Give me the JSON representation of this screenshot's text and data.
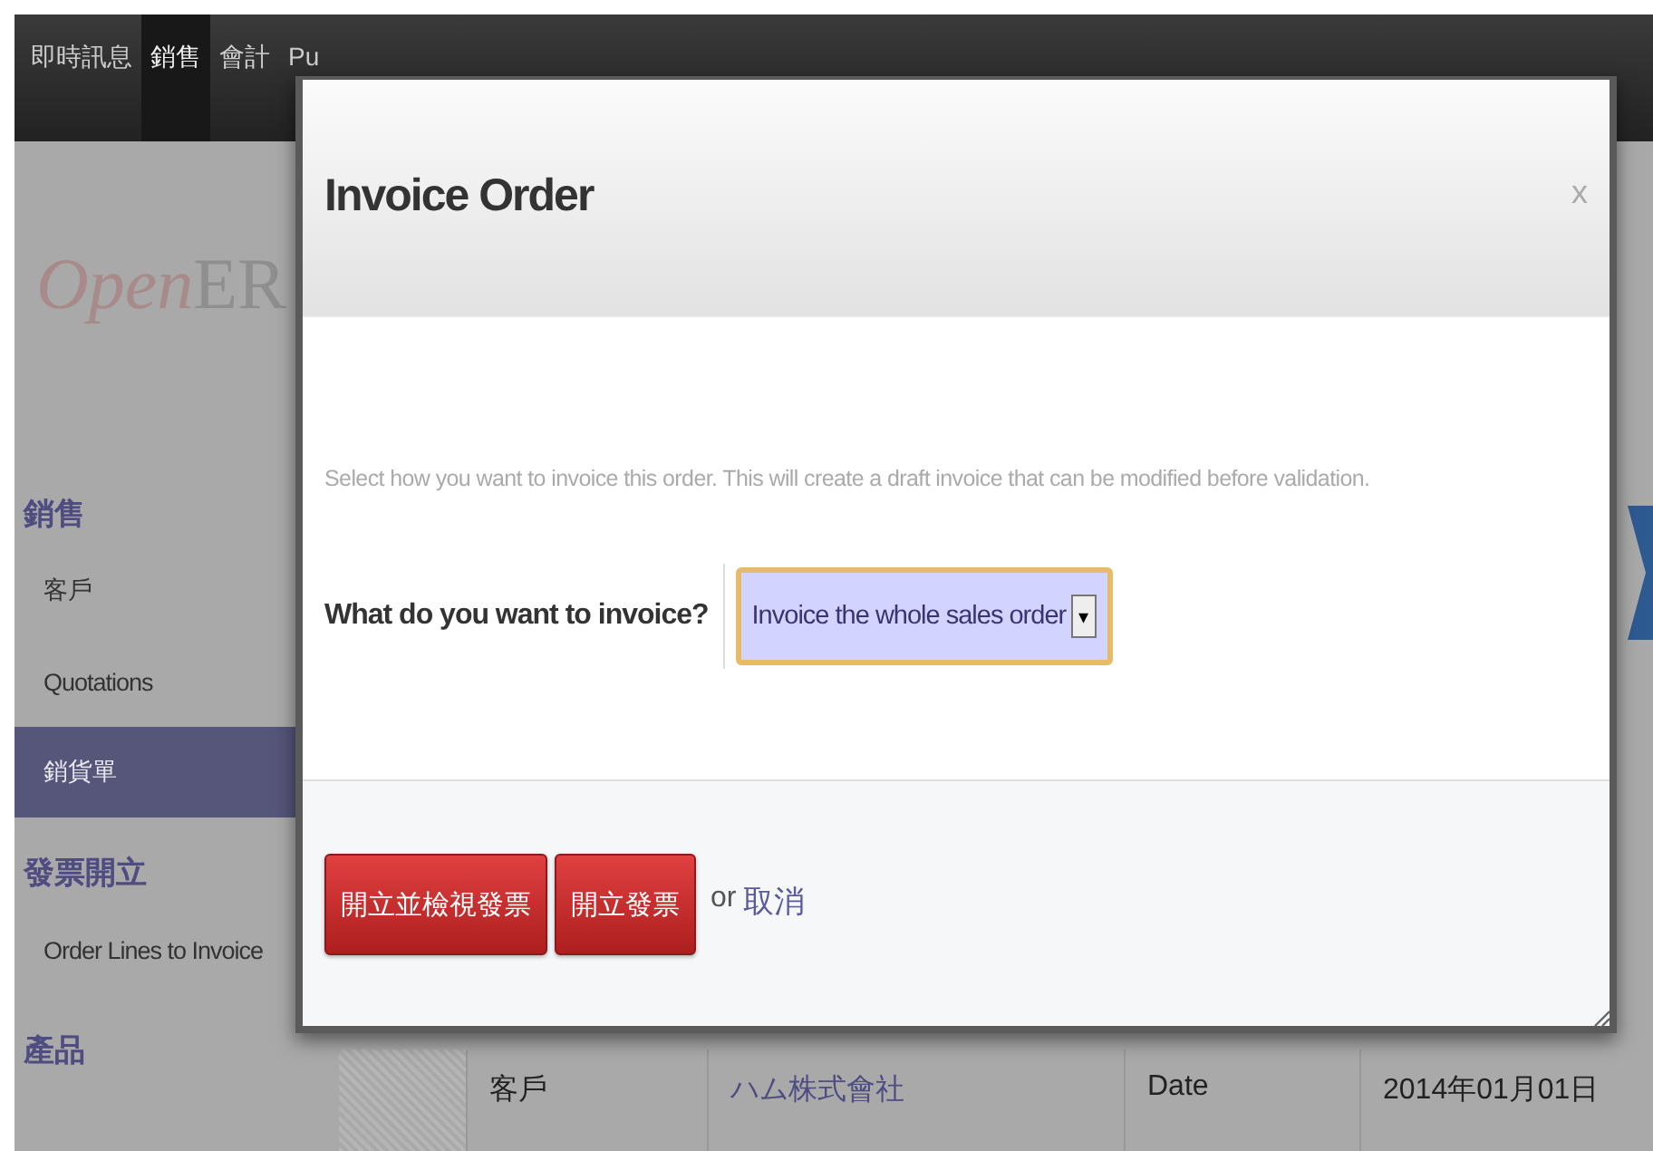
{
  "top_menu": [
    {
      "label": "即時訊息",
      "selected": false
    },
    {
      "label": "銷售",
      "selected": true
    },
    {
      "label": "會計",
      "selected": false
    },
    {
      "label": "Pu",
      "selected": false
    }
  ],
  "logo": {
    "part_1": "Open",
    "part_2": "ER"
  },
  "sidebar": {
    "sections": [
      {
        "heading": "銷售",
        "items": [
          {
            "label": "客戶",
            "selected": false
          },
          {
            "label": "Quotations",
            "selected": false
          },
          {
            "label": "銷貨單",
            "selected": true
          }
        ]
      },
      {
        "heading": "發票開立",
        "items": [
          {
            "label": "Order Lines to Invoice",
            "selected": false
          }
        ]
      },
      {
        "heading": "產品"
      }
    ]
  },
  "record": {
    "fields": [
      {
        "label": "客戶",
        "value": "ハム株式會社",
        "kind": "link"
      },
      {
        "label": "Date",
        "value": "2014年01月01日",
        "kind": "text"
      }
    ]
  },
  "dialog": {
    "title": "Invoice Order",
    "close": "x",
    "description": "Select how you want to invoice this order. This will create a draft invoice that can be modified before validation.",
    "field": {
      "label": "What do you want to invoice?",
      "value": "Invoice the whole sales order",
      "arrow": "▾"
    },
    "buttons": [
      "開立並檢視發票",
      "開立發票"
    ],
    "or": "or",
    "cancel": "取消"
  }
}
